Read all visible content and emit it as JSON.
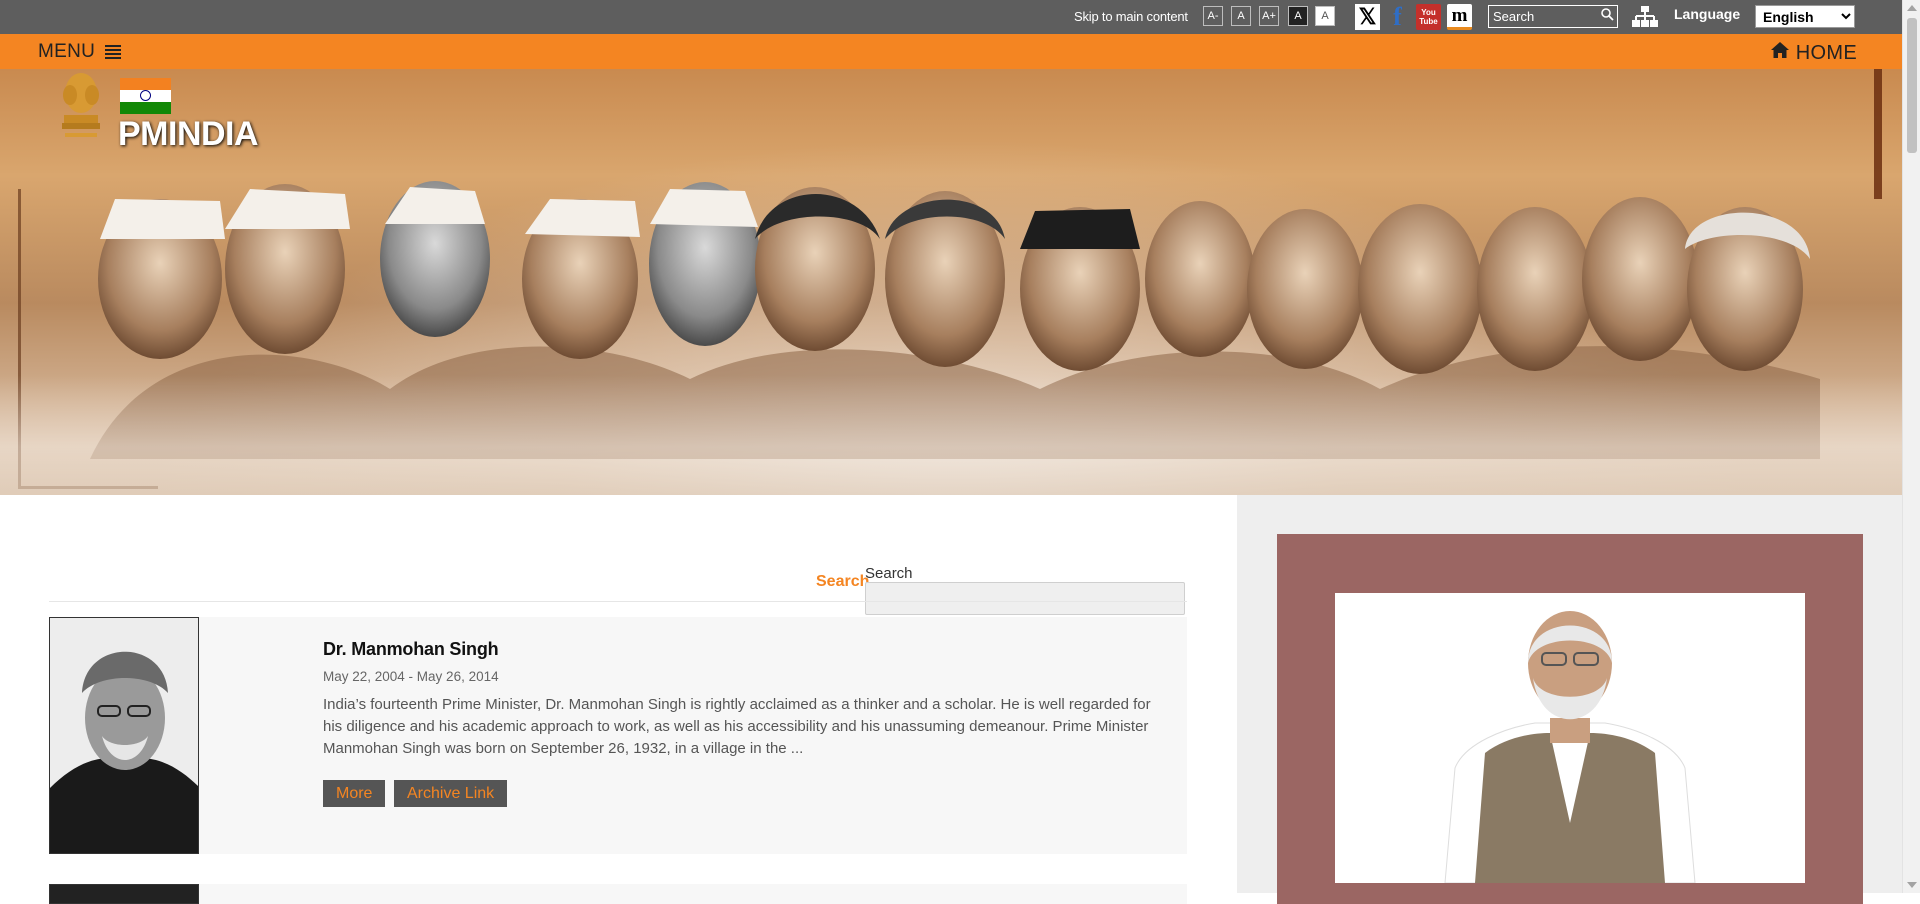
{
  "topbar": {
    "skip_link": "Skip to main content",
    "font_controls": [
      "A-",
      "A",
      "A+",
      "A",
      "A"
    ],
    "social_icons": [
      "x-twitter-icon",
      "facebook-icon",
      "youtube-icon",
      "mygov-icon"
    ],
    "youtube_top": "You",
    "youtube_bottom": "Tube",
    "search_placeholder": "Search",
    "sitemap_icon": "sitemap-icon",
    "language_label": "Language",
    "language_selected": "English"
  },
  "navbar": {
    "menu_label": "MENU",
    "home_label": "HOME",
    "menu_icon": "hamburger-icon",
    "home_icon": "home-icon"
  },
  "banner": {
    "brand": "PMINDIA",
    "emblem": "national-emblem-icon",
    "flag": "indian-flag-icon"
  },
  "search": {
    "link_label": "Search",
    "field_caption": "Search"
  },
  "pm_list": [
    {
      "name": "Dr. Manmohan Singh",
      "dates": "May 22, 2004 - May 26, 2014",
      "description": "India’s fourteenth Prime Minister, Dr. Manmohan Singh is rightly acclaimed as a thinker and a scholar. He is well regarded for his diligence and his academic approach to work, as well as his accessibility and his unassuming demeanour. Prime Minister Manmohan Singh was born on September 26, 1932, in a village in the ...",
      "more_label": "More",
      "archive_label": "Archive Link"
    }
  ],
  "colors": {
    "topbar": "#5e5e5e",
    "accent": "#f48522",
    "sidebar_box": "#9b6663",
    "button_bg": "#555555"
  }
}
